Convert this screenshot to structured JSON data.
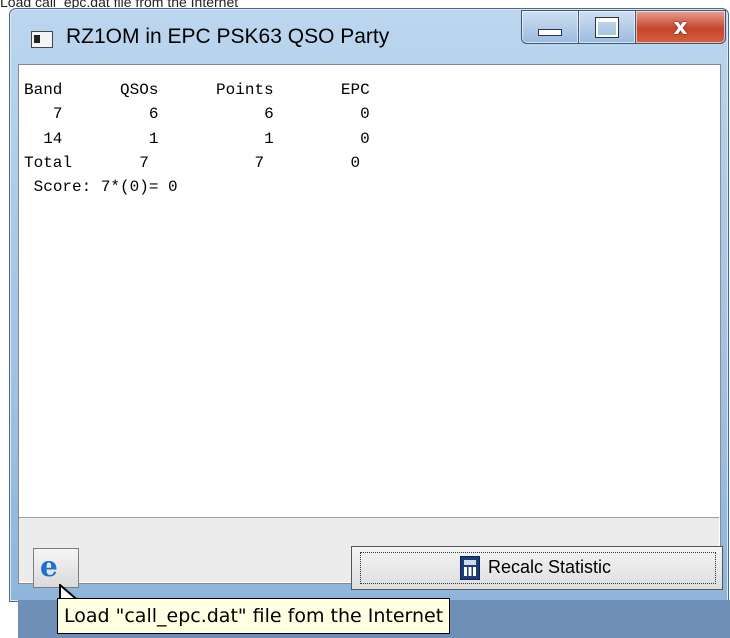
{
  "top_partial_text": "Load call_epc.dat file from the Internet",
  "window": {
    "title": "RZ1OM in EPC PSK63 QSO Party",
    "minimize_glyph": "",
    "maximize_glyph": "",
    "close_glyph": "x"
  },
  "stats": {
    "header": {
      "band": "Band",
      "qsos": "QSOs",
      "points": "Points",
      "epc": "EPC"
    },
    "rows": [
      {
        "band": "7",
        "qsos": "6",
        "points": "6",
        "epc": "0"
      },
      {
        "band": "14",
        "qsos": "1",
        "points": "1",
        "epc": "0"
      }
    ],
    "total": {
      "band": "Total",
      "qsos": "7",
      "points": "7",
      "epc": "0"
    },
    "score": "Score: 7*(0)= 0"
  },
  "toolbar": {
    "load_icon": "internet-explorer-icon",
    "recalc_label": "Recalc Statistic",
    "recalc_icon": "calculator-icon"
  },
  "tooltip": "Load \"call_epc.dat\" file fom the Internet",
  "colors": {
    "title_bar": "#a9c8e8",
    "close_button": "#c4462e",
    "tooltip_bg": "#ffffe1"
  }
}
